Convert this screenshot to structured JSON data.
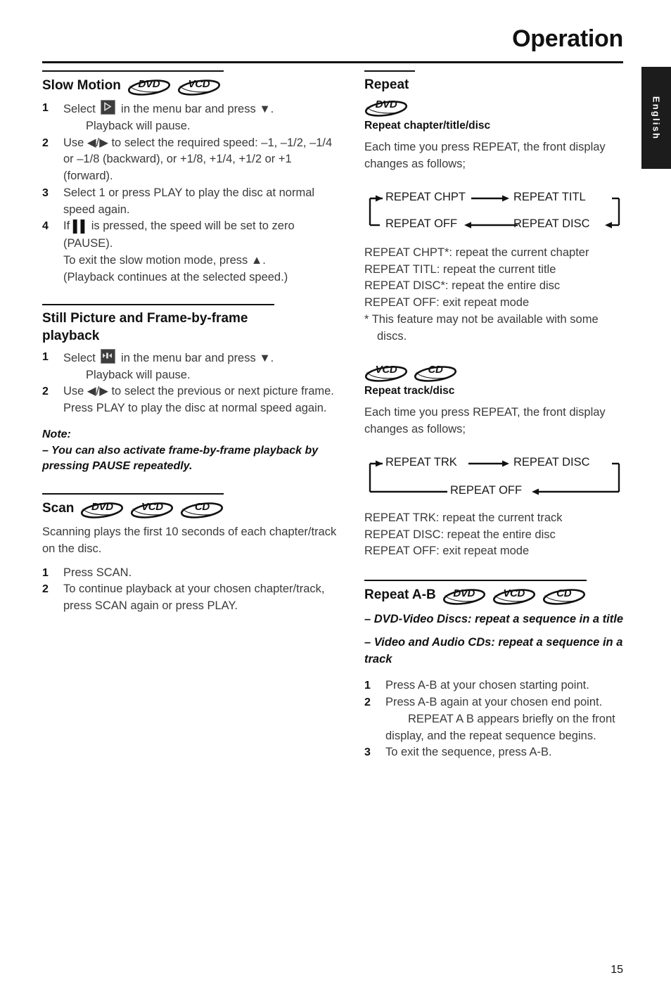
{
  "header": {
    "title": "Operation",
    "language_tab": "English"
  },
  "page_number": "15",
  "badges": {
    "dvd": "DVD",
    "vcd": "VCD",
    "cd": "CD"
  },
  "left_column": {
    "slow_motion": {
      "title": "Slow Motion",
      "discs": [
        "DVD",
        "VCD"
      ],
      "steps": [
        {
          "num": "1",
          "text_before_icon": "Select ",
          "icon": "play-button-icon",
          "text_after_icon": " in the menu bar and press ▼.",
          "sub": "Playback will pause."
        },
        {
          "num": "2",
          "text": "Use ◀/▶ to select the required speed: –1, –1/2, –1/4 or –1/8 (backward), or +1/8, +1/4, +1/2 or +1 (forward)."
        },
        {
          "num": "3",
          "text": "Select 1 or press PLAY to play the disc at normal speed again."
        },
        {
          "num": "4",
          "text_before_icon": "If ",
          "icon": "pause-icon",
          "text_after_icon": " is pressed, the speed will be set to zero (PAUSE).",
          "extra_lines": [
            "To exit the slow motion mode, press ▲.",
            "(Playback continues at the selected speed.)"
          ]
        }
      ]
    },
    "still_picture": {
      "title": "Still Picture and Frame-by-frame playback",
      "steps": [
        {
          "num": "1",
          "text_before_icon": "Select ",
          "icon": "frame-step-icon",
          "text_after_icon": " in the menu bar and press ▼.",
          "sub": "Playback will pause."
        },
        {
          "num": "2",
          "text": "Use ◀/▶ to select the previous or next picture frame.",
          "extra_lines": [
            "Press PLAY to play the disc at normal speed again."
          ]
        }
      ],
      "note_label": "Note:",
      "note_text": "–   You can also activate frame-by-frame playback by pressing PAUSE repeatedly."
    },
    "scan": {
      "title": "Scan",
      "discs": [
        "DVD",
        "VCD",
        "CD"
      ],
      "intro": "Scanning plays the first 10 seconds of each chapter/track on the disc.",
      "steps": [
        {
          "num": "1",
          "text": "Press SCAN."
        },
        {
          "num": "2",
          "text": "To continue playback at your chosen chapter/track, press SCAN again or press PLAY."
        }
      ]
    }
  },
  "right_column": {
    "repeat": {
      "title": "Repeat",
      "discs": [
        "DVD"
      ],
      "subtitle": "Repeat chapter/title/disc",
      "intro": "Each time you press REPEAT, the front display changes as follows;",
      "flow": {
        "nodes": [
          "REPEAT CHPT",
          "REPEAT TITL",
          "REPEAT DISC",
          "REPEAT OFF"
        ],
        "type": "cycle-4"
      },
      "definitions": [
        "REPEAT CHPT*: repeat the current chapter",
        "REPEAT TITL: repeat the current title",
        "REPEAT DISC*: repeat the entire disc",
        "REPEAT OFF: exit repeat mode"
      ],
      "footnote": "*   This feature may not be available with some discs."
    },
    "repeat_track": {
      "discs": [
        "VCD",
        "CD"
      ],
      "subtitle": "Repeat track/disc",
      "intro": "Each time you press REPEAT, the front display changes as follows;",
      "flow": {
        "nodes": [
          "REPEAT TRK",
          "REPEAT DISC",
          "REPEAT OFF"
        ],
        "type": "cycle-3"
      },
      "definitions": [
        "REPEAT TRK: repeat the current track",
        "REPEAT DISC: repeat the entire disc",
        "REPEAT OFF: exit repeat mode"
      ]
    },
    "repeat_ab": {
      "title": "Repeat A-B",
      "discs": [
        "DVD",
        "VCD",
        "CD"
      ],
      "bullets": [
        "–   DVD-Video Discs: repeat a sequence in a title",
        "–   Video and Audio CDs: repeat a sequence in a track"
      ],
      "steps": [
        {
          "num": "1",
          "text": "Press A-B at your chosen starting point."
        },
        {
          "num": "2",
          "text": "Press A-B again at your chosen end point.",
          "sub": "REPEAT A B appears briefly on the front",
          "extra_lines": [
            "display, and the repeat sequence begins."
          ]
        },
        {
          "num": "3",
          "text": "To exit the sequence, press A-B."
        }
      ]
    }
  }
}
